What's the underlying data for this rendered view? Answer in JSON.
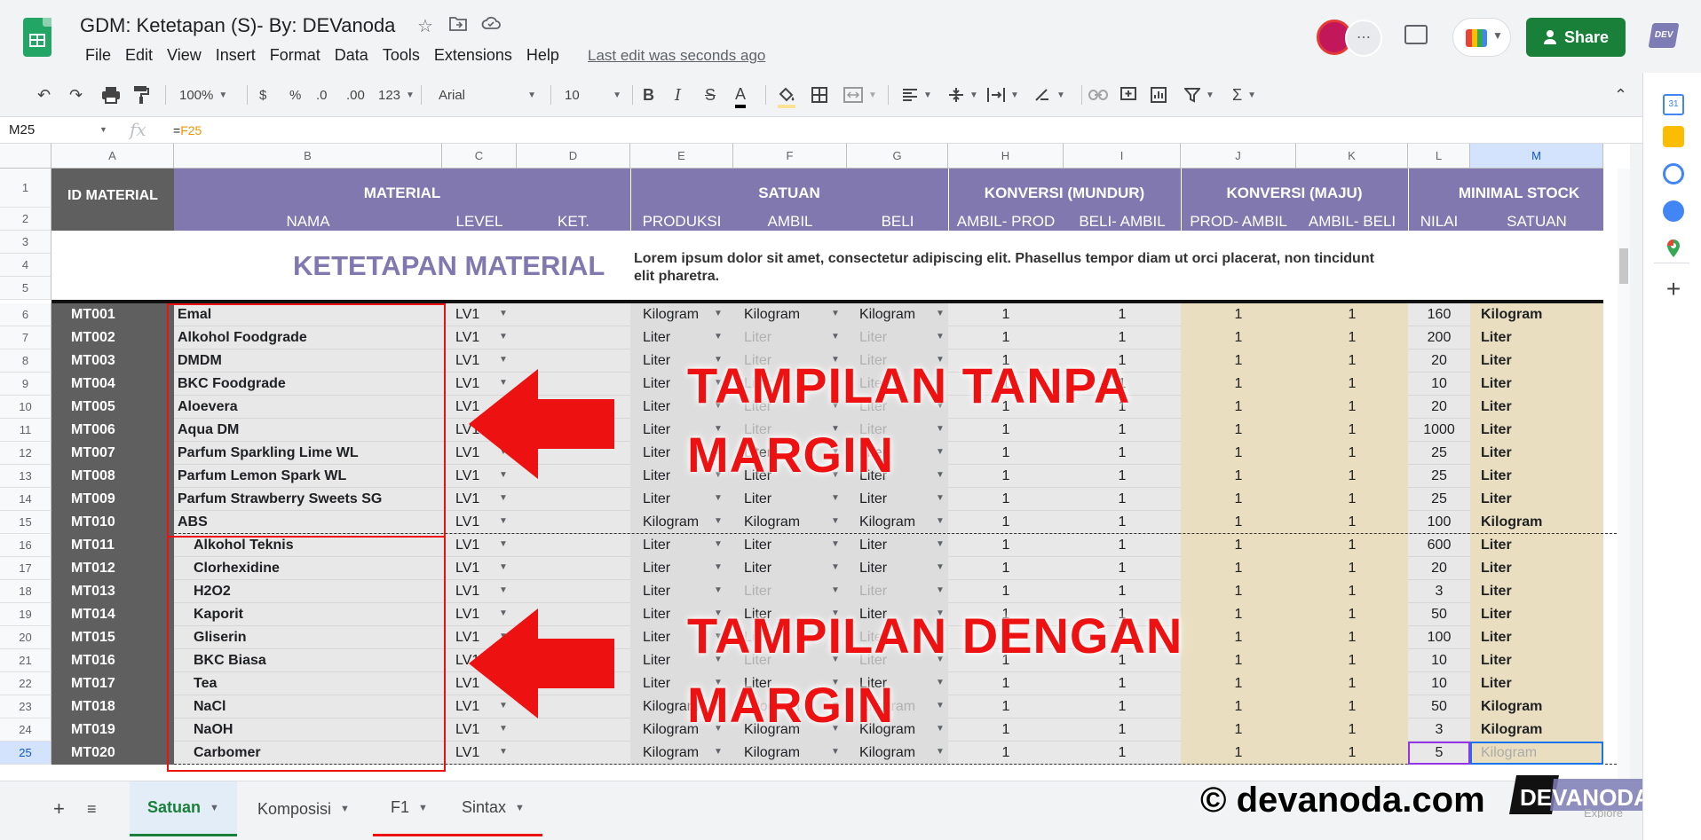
{
  "app": {
    "title": "GDM: Ketetapan (S)- By: DEVanoda",
    "menu": [
      "File",
      "Edit",
      "View",
      "Insert",
      "Format",
      "Data",
      "Tools",
      "Extensions",
      "Help"
    ],
    "last_edit": "Last edit was seconds ago",
    "share_label": "Share",
    "dev_logo_text": "DEV"
  },
  "toolbar": {
    "zoom": "100%",
    "currency": "$",
    "percent": "%",
    "decrease_decimal": ".0",
    "increase_decimal": ".00",
    "number_format": "123",
    "font": "Arial",
    "font_size": "10",
    "bold": "B",
    "italic": "I",
    "strike": "S",
    "text_color": "A"
  },
  "formula_bar": {
    "name_box": "M25",
    "fx": "fx",
    "formula_prefix": "=",
    "formula_ref": "F25"
  },
  "columns": [
    "A",
    "B",
    "C",
    "D",
    "E",
    "F",
    "G",
    "H",
    "I",
    "J",
    "K",
    "L",
    "M"
  ],
  "header": {
    "id_material": "ID MATERIAL",
    "material": "MATERIAL",
    "satuan": "SATUAN",
    "konversi_mundur": "KONVERSI (MUNDUR)",
    "konversi_maju": "KONVERSI (MAJU)",
    "minimal_stock": "MINIMAL STOCK",
    "sub": {
      "nama": "NAMA",
      "level": "LEVEL",
      "ket": "KET.",
      "produksi": "PRODUKSI",
      "ambil": "AMBIL",
      "beli": "BELI",
      "ambil_prod": "AMBIL- PROD",
      "beli_ambil": "BELI- AMBIL",
      "prod_ambil": "PROD- AMBIL",
      "ambil_beli": "AMBIL- BELI",
      "nilai": "NILAI",
      "satuan": "SATUAN"
    }
  },
  "banner": {
    "title": "KETETAPAN MATERIAL",
    "description": "Lorem ipsum dolor sit amet, consectetur adipiscing elit. Phasellus tempor diam ut orci placerat, non tincidunt elit pharetra."
  },
  "rows": [
    {
      "num": 6,
      "id": "MT001",
      "nama": "Emal",
      "level": "LV1",
      "produksi": "Kilogram",
      "ambil": "Kilogram",
      "beli": "Kilogram",
      "h": "1",
      "i": "1",
      "j": "1",
      "k": "1",
      "nilai": "160",
      "satuan": "Kilogram",
      "indent": false
    },
    {
      "num": 7,
      "id": "MT002",
      "nama": "Alkohol Foodgrade",
      "level": "LV1",
      "produksi": "Liter",
      "ambil": "Liter",
      "beli": "Liter",
      "h": "1",
      "i": "1",
      "j": "1",
      "k": "1",
      "nilai": "200",
      "satuan": "Liter",
      "indent": false
    },
    {
      "num": 8,
      "id": "MT003",
      "nama": "DMDM",
      "level": "LV1",
      "produksi": "Liter",
      "ambil": "Liter",
      "beli": "Liter",
      "h": "1",
      "i": "1",
      "j": "1",
      "k": "1",
      "nilai": "20",
      "satuan": "Liter",
      "indent": false
    },
    {
      "num": 9,
      "id": "MT004",
      "nama": "BKC Foodgrade",
      "level": "LV1",
      "produksi": "Liter",
      "ambil": "Liter",
      "beli": "Liter",
      "h": "1",
      "i": "1",
      "j": "1",
      "k": "1",
      "nilai": "10",
      "satuan": "Liter",
      "indent": false
    },
    {
      "num": 10,
      "id": "MT005",
      "nama": "Aloevera",
      "level": "LV1",
      "produksi": "Liter",
      "ambil": "Liter",
      "beli": "Liter",
      "h": "1",
      "i": "1",
      "j": "1",
      "k": "1",
      "nilai": "20",
      "satuan": "Liter",
      "indent": false
    },
    {
      "num": 11,
      "id": "MT006",
      "nama": "Aqua DM",
      "level": "LV1",
      "produksi": "Liter",
      "ambil": "Liter",
      "beli": "Liter",
      "h": "1",
      "i": "1",
      "j": "1",
      "k": "1",
      "nilai": "1000",
      "satuan": "Liter",
      "indent": false
    },
    {
      "num": 12,
      "id": "MT007",
      "nama": "Parfum Sparkling Lime WL",
      "level": "LV1",
      "produksi": "Liter",
      "ambil": "Liter",
      "beli": "Liter",
      "h": "1",
      "i": "1",
      "j": "1",
      "k": "1",
      "nilai": "25",
      "satuan": "Liter",
      "indent": false
    },
    {
      "num": 13,
      "id": "MT008",
      "nama": "Parfum Lemon Spark WL",
      "level": "LV1",
      "produksi": "Liter",
      "ambil": "Liter",
      "beli": "Liter",
      "h": "1",
      "i": "1",
      "j": "1",
      "k": "1",
      "nilai": "25",
      "satuan": "Liter",
      "indent": false
    },
    {
      "num": 14,
      "id": "MT009",
      "nama": "Parfum Strawberry Sweets SG",
      "level": "LV1",
      "produksi": "Liter",
      "ambil": "Liter",
      "beli": "Liter",
      "h": "1",
      "i": "1",
      "j": "1",
      "k": "1",
      "nilai": "25",
      "satuan": "Liter",
      "indent": false
    },
    {
      "num": 15,
      "id": "MT010",
      "nama": "ABS",
      "level": "LV1",
      "produksi": "Kilogram",
      "ambil": "Kilogram",
      "beli": "Kilogram",
      "h": "1",
      "i": "1",
      "j": "1",
      "k": "1",
      "nilai": "100",
      "satuan": "Kilogram",
      "indent": false
    },
    {
      "num": 16,
      "id": "MT011",
      "nama": "Alkohol Teknis",
      "level": "LV1",
      "produksi": "Liter",
      "ambil": "Liter",
      "beli": "Liter",
      "h": "1",
      "i": "1",
      "j": "1",
      "k": "1",
      "nilai": "600",
      "satuan": "Liter",
      "indent": true
    },
    {
      "num": 17,
      "id": "MT012",
      "nama": "Clorhexidine",
      "level": "LV1",
      "produksi": "Liter",
      "ambil": "Liter",
      "beli": "Liter",
      "h": "1",
      "i": "1",
      "j": "1",
      "k": "1",
      "nilai": "20",
      "satuan": "Liter",
      "indent": true
    },
    {
      "num": 18,
      "id": "MT013",
      "nama": "H2O2",
      "level": "LV1",
      "produksi": "Liter",
      "ambil": "Liter",
      "beli": "Liter",
      "h": "1",
      "i": "1",
      "j": "1",
      "k": "1",
      "nilai": "3",
      "satuan": "Liter",
      "indent": true
    },
    {
      "num": 19,
      "id": "MT014",
      "nama": "Kaporit",
      "level": "LV1",
      "produksi": "Liter",
      "ambil": "Liter",
      "beli": "Liter",
      "h": "1",
      "i": "1",
      "j": "1",
      "k": "1",
      "nilai": "50",
      "satuan": "Liter",
      "indent": true
    },
    {
      "num": 20,
      "id": "MT015",
      "nama": "Gliserin",
      "level": "LV1",
      "produksi": "Liter",
      "ambil": "Liter",
      "beli": "Liter",
      "h": "1",
      "i": "1",
      "j": "1",
      "k": "1",
      "nilai": "100",
      "satuan": "Liter",
      "indent": true
    },
    {
      "num": 21,
      "id": "MT016",
      "nama": "BKC Biasa",
      "level": "LV1",
      "produksi": "Liter",
      "ambil": "Liter",
      "beli": "Liter",
      "h": "1",
      "i": "1",
      "j": "1",
      "k": "1",
      "nilai": "10",
      "satuan": "Liter",
      "indent": true
    },
    {
      "num": 22,
      "id": "MT017",
      "nama": "Tea",
      "level": "LV1",
      "produksi": "Liter",
      "ambil": "Liter",
      "beli": "Liter",
      "h": "1",
      "i": "1",
      "j": "1",
      "k": "1",
      "nilai": "10",
      "satuan": "Liter",
      "indent": true
    },
    {
      "num": 23,
      "id": "MT018",
      "nama": "NaCl",
      "level": "LV1",
      "produksi": "Kilogram",
      "ambil": "Kilogram",
      "beli": "Kilogram",
      "h": "1",
      "i": "1",
      "j": "1",
      "k": "1",
      "nilai": "50",
      "satuan": "Kilogram",
      "indent": true
    },
    {
      "num": 24,
      "id": "MT019",
      "nama": "NaOH",
      "level": "LV1",
      "produksi": "Kilogram",
      "ambil": "Kilogram",
      "beli": "Kilogram",
      "h": "1",
      "i": "1",
      "j": "1",
      "k": "1",
      "nilai": "3",
      "satuan": "Kilogram",
      "indent": true
    },
    {
      "num": 25,
      "id": "MT020",
      "nama": "Carbomer",
      "level": "LV1",
      "produksi": "Kilogram",
      "ambil": "Kilogram",
      "beli": "Kilogram",
      "h": "1",
      "i": "1",
      "j": "1",
      "k": "1",
      "nilai": "5",
      "satuan": "Kilogram",
      "indent": true
    }
  ],
  "annotations": {
    "label_1_line_1": "TAMPILAN TANPA",
    "label_1_line_2": "MARGIN",
    "label_2_line_1": "TAMPILAN DENGAN",
    "label_2_line_2": "MARGIN"
  },
  "tabs": [
    {
      "label": "Satuan",
      "active": true
    },
    {
      "label": "Komposisi",
      "active": false
    },
    {
      "label": "F1",
      "active": false
    },
    {
      "label": "Sintax",
      "active": false
    }
  ],
  "branding": {
    "copyright": "© devanoda.com",
    "logo_text": "DEVANODA",
    "explore": "Explore"
  },
  "colors": {
    "header_purple": "#8178b0",
    "id_column": "#5f5f5f",
    "konversi_maju_fill": "#e9dfc0",
    "minimal_stock_fill": "#e9dfc0",
    "banner_title": "#8178b0",
    "annotation_red": "#ee1111",
    "share_green": "#188038"
  }
}
